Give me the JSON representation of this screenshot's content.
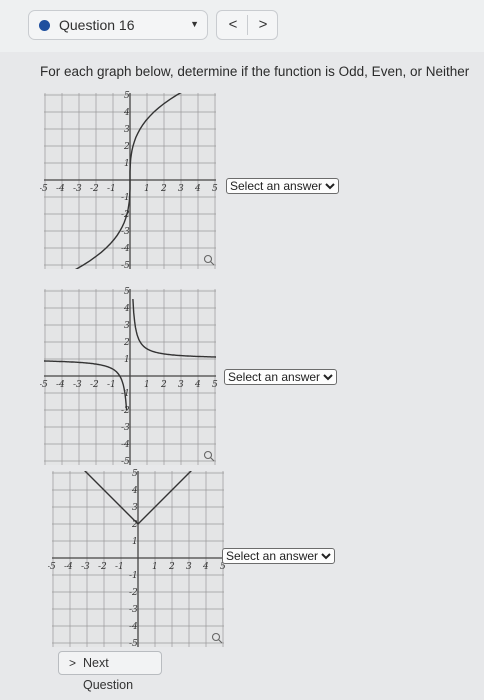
{
  "header": {
    "question_label": "Question 16",
    "prev_symbol": "<",
    "next_symbol": ">"
  },
  "instructions": "For each graph below, determine if the function is Odd, Even, or Neither",
  "graphs": [
    {
      "answer_label": "Select an answer"
    },
    {
      "answer_label": "Select an answer"
    },
    {
      "answer_label": "Select an answer"
    }
  ],
  "graph_ticks": {
    "x": [
      "-5",
      "-4",
      "-3",
      "-2",
      "-1",
      "1",
      "2",
      "3",
      "4",
      "5"
    ],
    "y": [
      "5",
      "4",
      "3",
      "2",
      "1",
      "-1",
      "-2",
      "-3",
      "-4",
      "-5"
    ]
  },
  "footer": {
    "arrow": ">",
    "next_label": "Next Question"
  },
  "colors": {
    "accent": "#1f4f9e",
    "grid": "#9a9a9a",
    "curve": "#333333"
  },
  "icons": {
    "zoom": "magnifier-icon",
    "dropdown": "chevron-down-icon"
  }
}
